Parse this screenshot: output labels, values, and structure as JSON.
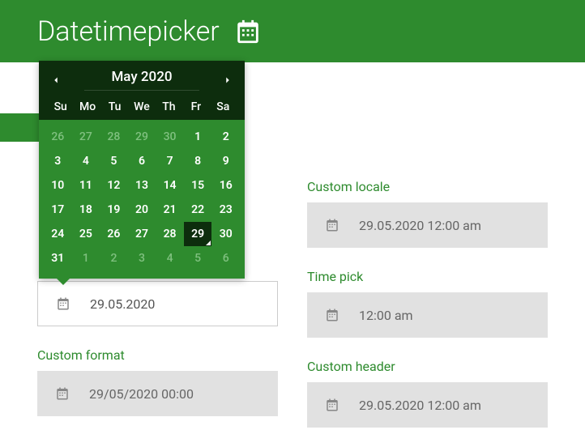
{
  "header": {
    "title": "Datetimepicker"
  },
  "calendar": {
    "title": "May 2020",
    "dow": [
      "Su",
      "Mo",
      "Tu",
      "We",
      "Th",
      "Fr",
      "Sa"
    ],
    "days": [
      {
        "n": "26",
        "other": true
      },
      {
        "n": "27",
        "other": true
      },
      {
        "n": "28",
        "other": true
      },
      {
        "n": "29",
        "other": true
      },
      {
        "n": "30",
        "other": true
      },
      {
        "n": "1"
      },
      {
        "n": "2"
      },
      {
        "n": "3"
      },
      {
        "n": "4"
      },
      {
        "n": "5"
      },
      {
        "n": "6"
      },
      {
        "n": "7"
      },
      {
        "n": "8"
      },
      {
        "n": "9"
      },
      {
        "n": "10"
      },
      {
        "n": "11"
      },
      {
        "n": "12"
      },
      {
        "n": "13"
      },
      {
        "n": "14"
      },
      {
        "n": "15"
      },
      {
        "n": "16"
      },
      {
        "n": "17"
      },
      {
        "n": "18"
      },
      {
        "n": "19"
      },
      {
        "n": "20"
      },
      {
        "n": "21"
      },
      {
        "n": "22"
      },
      {
        "n": "23"
      },
      {
        "n": "24"
      },
      {
        "n": "25"
      },
      {
        "n": "26"
      },
      {
        "n": "27"
      },
      {
        "n": "28"
      },
      {
        "n": "29",
        "selected": true
      },
      {
        "n": "30"
      },
      {
        "n": "31"
      },
      {
        "n": "1",
        "other": true
      },
      {
        "n": "2",
        "other": true
      },
      {
        "n": "3",
        "other": true
      },
      {
        "n": "4",
        "other": true
      },
      {
        "n": "5",
        "other": true
      },
      {
        "n": "6",
        "other": true
      }
    ]
  },
  "left": {
    "date_value": "29.05.2020",
    "custom_format_label": "Custom format",
    "custom_format_value": "29/05/2020 00:00"
  },
  "right": {
    "custom_locale_label": "Custom locale",
    "custom_locale_value": "29.05.2020 12:00 am",
    "time_pick_label": "Time pick",
    "time_pick_value": "12:00 am",
    "custom_header_label": "Custom header",
    "custom_header_value": "29.05.2020 12:00 am"
  }
}
